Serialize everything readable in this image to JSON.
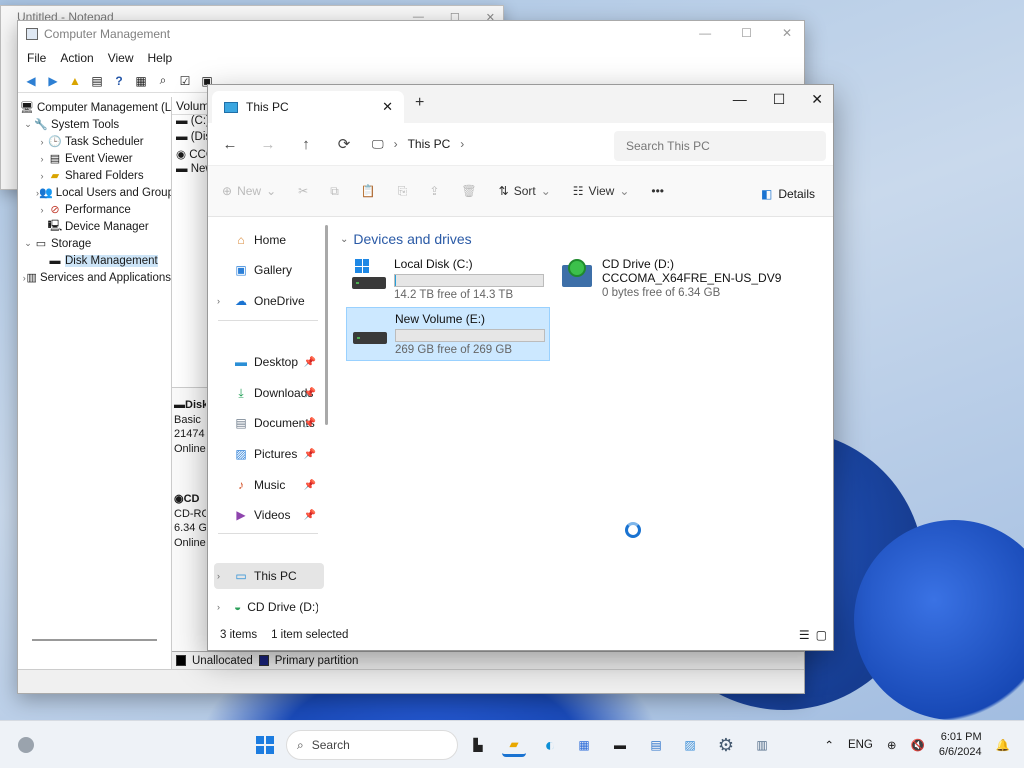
{
  "desktop": {
    "accent": "#1a4ab8"
  },
  "notepad": {
    "title": "Untitled - Notepad"
  },
  "computer_management": {
    "title": "Computer Management",
    "menu": [
      "File",
      "Action",
      "View",
      "Help"
    ],
    "tree": [
      {
        "label": "Computer Management (Local",
        "indent": 0,
        "arrow": "",
        "icon": "computer-icon"
      },
      {
        "label": "System Tools",
        "indent": 1,
        "arrow": "v",
        "icon": "tools-icon"
      },
      {
        "label": "Task Scheduler",
        "indent": 2,
        "arrow": ">",
        "icon": "clock-icon"
      },
      {
        "label": "Event Viewer",
        "indent": 2,
        "arrow": ">",
        "icon": "event-viewer-icon"
      },
      {
        "label": "Shared Folders",
        "indent": 2,
        "arrow": ">",
        "icon": "folder-icon"
      },
      {
        "label": "Local Users and Groups",
        "indent": 2,
        "arrow": ">",
        "icon": "users-icon"
      },
      {
        "label": "Performance",
        "indent": 2,
        "arrow": ">",
        "icon": "performance-icon"
      },
      {
        "label": "Device Manager",
        "indent": 2,
        "arrow": "",
        "icon": "device-manager-icon"
      },
      {
        "label": "Storage",
        "indent": 1,
        "arrow": "v",
        "icon": "storage-icon"
      },
      {
        "label": "Disk Management",
        "indent": 2,
        "arrow": "",
        "icon": "disk-icon",
        "selected": true
      },
      {
        "label": "Services and Applications",
        "indent": 1,
        "arrow": ">",
        "icon": "services-icon"
      }
    ],
    "volume_header": "Volum",
    "volume_rows": [
      "(C:)",
      "(Disk",
      "CCCO",
      "New"
    ],
    "disk0": [
      "Disk",
      "Basic",
      "21474",
      "Online"
    ],
    "disk1": [
      "CD",
      "CD-RO",
      "6.34 G",
      "Online"
    ],
    "legend": {
      "unallocated": "Unallocated",
      "primary": "Primary partition"
    }
  },
  "explorer": {
    "tab_title": "This PC",
    "breadcrumb": "This PC",
    "search_placeholder": "Search This PC",
    "commands": {
      "new": "New",
      "sort": "Sort",
      "view": "View",
      "details": "Details"
    },
    "nav": {
      "home": "Home",
      "gallery": "Gallery",
      "onedrive": "OneDrive",
      "desktop": "Desktop",
      "downloads": "Downloads",
      "documents": "Documents",
      "pictures": "Pictures",
      "music": "Music",
      "videos": "Videos",
      "thispc": "This PC",
      "cddrive": "CD Drive (D:) CC"
    },
    "group_header": "Devices and drives",
    "drives": {
      "c": {
        "name": "Local Disk (C:)",
        "free": "14.2 TB free of 14.3 TB",
        "used_fraction": 0.01
      },
      "d": {
        "name": "CD Drive (D:)",
        "label": "CCCOMA_X64FRE_EN-US_DV9",
        "free": "0 bytes free of 6.34 GB"
      },
      "e": {
        "name": "New Volume (E:)",
        "free": "269 GB free of 269 GB",
        "used_fraction": 0.0
      }
    },
    "status": {
      "items": "3 items",
      "selected": "1 item selected"
    }
  },
  "taskbar": {
    "search": "Search",
    "lang": "ENG",
    "time": "6:01 PM",
    "date": "6/6/2024"
  }
}
